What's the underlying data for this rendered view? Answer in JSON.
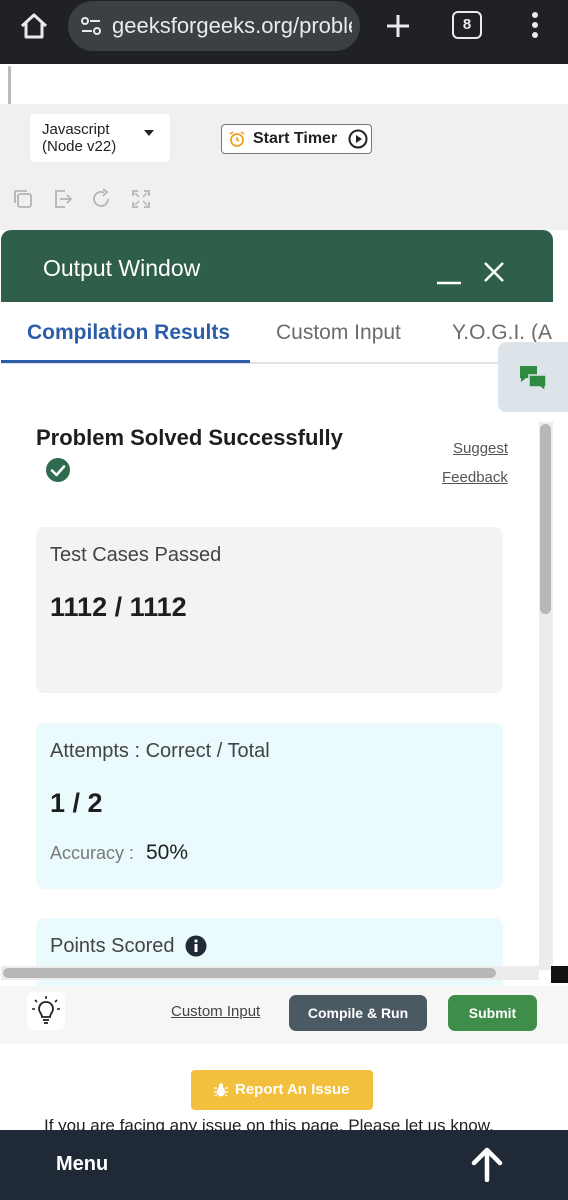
{
  "browser": {
    "url": "geeksforgeeks.org/problems",
    "tab_count": "8"
  },
  "editor": {
    "language": "Javascript (Node v22)",
    "timer_label": "Start Timer"
  },
  "output_window": {
    "title": "Output Window",
    "tabs": [
      "Compilation Results",
      "Custom Input",
      "Y.O.G.I. (AI"
    ],
    "active_tab": "Compilation Results",
    "status": "Problem Solved Successfully",
    "suggest": "Suggest",
    "feedback": "Feedback",
    "test_cases": {
      "label": "Test Cases Passed",
      "value": "1112 / 1112"
    },
    "attempts": {
      "label": "Attempts : Correct / Total",
      "value": "1 / 2",
      "accuracy_label": "Accuracy :",
      "accuracy_value": "50%"
    },
    "points": {
      "label": "Points Scored"
    }
  },
  "actions": {
    "custom_input": "Custom Input",
    "compile_run": "Compile & Run",
    "submit": "Submit"
  },
  "report": {
    "button": "Report An Issue",
    "text": "If you are facing any issue on this page. Please let us know."
  },
  "footer": {
    "menu": "Menu"
  },
  "colors": {
    "header_green": "#2f5f4b",
    "tab_blue": "#2b5ea7",
    "submit_green": "#3f8d4a",
    "compile_gray": "#4b5963",
    "report_yellow": "#f3c03d",
    "footer_navy": "#1f2a36"
  }
}
